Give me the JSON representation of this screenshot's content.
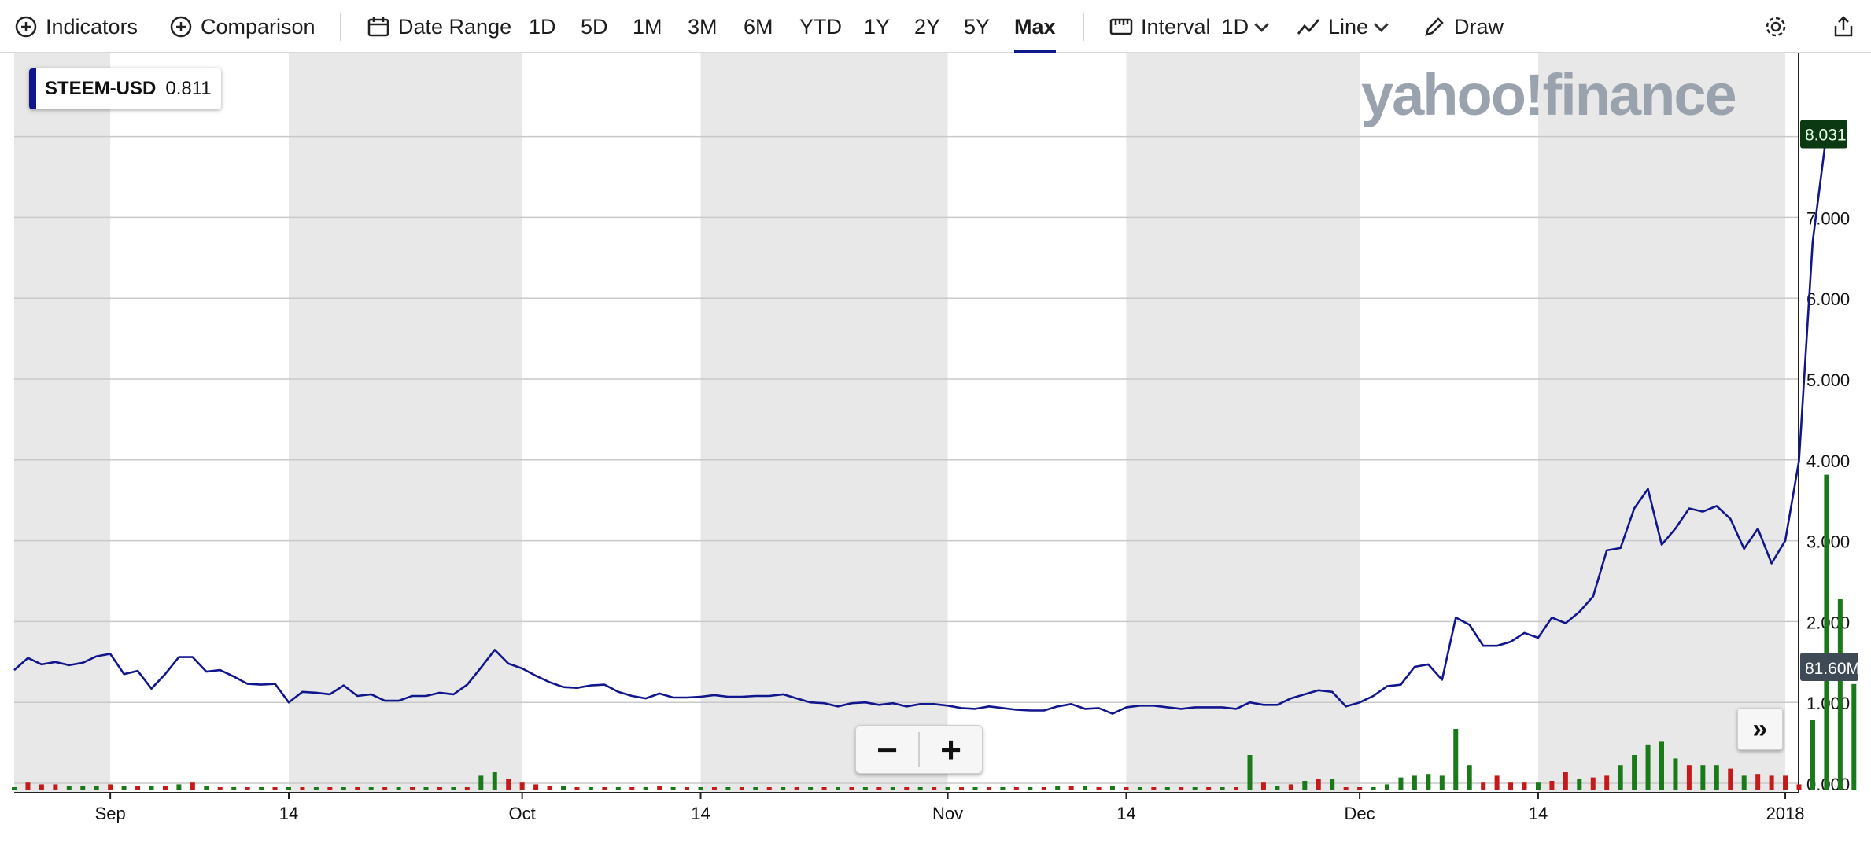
{
  "toolbar": {
    "indicators_label": "Indicators",
    "comparison_label": "Comparison",
    "date_range_label": "Date Range",
    "ranges": [
      "1D",
      "5D",
      "1M",
      "3M",
      "6M",
      "YTD",
      "1Y",
      "2Y",
      "5Y",
      "Max"
    ],
    "active_range": "Max",
    "interval_label": "Interval",
    "interval_value": "1D",
    "chart_type_label": "Line",
    "draw_label": "Draw"
  },
  "ticker": {
    "symbol": "STEEM-USD",
    "value": "0.811"
  },
  "logo_text": "yahoo!finance",
  "current_price_label": "8.031",
  "volume_label": "81.60M",
  "colors": {
    "line": "#12168c",
    "volume_up": "#1a7a1a",
    "volume_down": "#c51a1a",
    "band": "#e8e8e8",
    "accent": "#0f1a8c"
  },
  "chart_data": {
    "type": "line",
    "xlabel": "",
    "ylabel": "",
    "ylim": [
      0,
      9
    ],
    "yticks": [
      "0.000",
      "1.000",
      "2.000",
      "3.000",
      "4.000",
      "5.000",
      "6.000",
      "7.000"
    ],
    "x_start_date": "2017-08-25",
    "xticks": [
      "Sep",
      "14",
      "Oct",
      "14",
      "Nov",
      "14",
      "Dec",
      "14",
      "2018"
    ],
    "xtick_dates": [
      "2017-09-01",
      "2017-09-14",
      "2017-10-01",
      "2017-10-14",
      "2017-11-01",
      "2017-11-14",
      "2017-12-01",
      "2017-12-14",
      "2018-01-01"
    ],
    "grid": true,
    "series": [
      {
        "name": "STEEM-USD",
        "values": [
          1.4,
          1.55,
          1.47,
          1.5,
          1.46,
          1.49,
          1.57,
          1.6,
          1.35,
          1.39,
          1.17,
          1.35,
          1.56,
          1.56,
          1.38,
          1.4,
          1.32,
          1.23,
          1.22,
          1.23,
          1.0,
          1.13,
          1.12,
          1.1,
          1.21,
          1.08,
          1.1,
          1.02,
          1.02,
          1.08,
          1.08,
          1.12,
          1.1,
          1.22,
          1.43,
          1.65,
          1.48,
          1.42,
          1.33,
          1.25,
          1.19,
          1.18,
          1.21,
          1.22,
          1.13,
          1.08,
          1.05,
          1.11,
          1.06,
          1.06,
          1.07,
          1.09,
          1.07,
          1.07,
          1.08,
          1.08,
          1.1,
          1.05,
          1.0,
          0.99,
          0.95,
          0.99,
          1.0,
          0.97,
          0.99,
          0.95,
          0.98,
          0.98,
          0.96,
          0.93,
          0.92,
          0.95,
          0.93,
          0.91,
          0.9,
          0.9,
          0.95,
          0.98,
          0.92,
          0.93,
          0.86,
          0.94,
          0.96,
          0.96,
          0.94,
          0.92,
          0.94,
          0.94,
          0.94,
          0.92,
          1.0,
          0.97,
          0.97,
          1.05,
          1.1,
          1.15,
          1.13,
          0.95,
          1.0,
          1.08,
          1.2,
          1.22,
          1.44,
          1.47,
          1.28,
          2.05,
          1.96,
          1.7,
          1.7,
          1.75,
          1.86,
          1.8,
          2.05,
          1.98,
          2.12,
          2.31,
          2.88,
          2.91,
          3.4,
          3.64,
          2.95,
          3.15,
          3.4,
          3.36,
          3.43,
          3.27,
          2.9,
          3.15,
          2.72,
          3.0,
          3.99,
          6.7,
          8.03
        ],
        "volume_direction": [
          "u",
          "d",
          "d",
          "d",
          "u",
          "u",
          "u",
          "d",
          "u",
          "d",
          "u",
          "d",
          "u",
          "d",
          "u",
          "d",
          "u",
          "d",
          "u",
          "d",
          "u",
          "d",
          "u",
          "d",
          "u",
          "d",
          "u",
          "d",
          "u",
          "d",
          "u",
          "d",
          "u",
          "d",
          "u",
          "u",
          "d",
          "d",
          "d",
          "d",
          "u",
          "d",
          "u",
          "d",
          "u",
          "d",
          "u",
          "d",
          "u",
          "d",
          "u",
          "d",
          "u",
          "d",
          "u",
          "d",
          "u",
          "d",
          "u",
          "d",
          "u",
          "d",
          "u",
          "d",
          "u",
          "d",
          "u",
          "d",
          "u",
          "d",
          "u",
          "d",
          "u",
          "d",
          "u",
          "d",
          "u",
          "d",
          "u",
          "d",
          "u",
          "d",
          "u",
          "d",
          "u",
          "d",
          "u",
          "d",
          "u",
          "d",
          "u",
          "d",
          "u",
          "d",
          "u",
          "d",
          "u",
          "d",
          "d",
          "u",
          "u",
          "u",
          "u",
          "u",
          "u",
          "u",
          "u",
          "d",
          "d",
          "d",
          "d",
          "u",
          "d",
          "d",
          "u",
          "d",
          "d",
          "u",
          "u",
          "u",
          "u",
          "u",
          "d",
          "u",
          "u",
          "d",
          "u",
          "d",
          "d",
          "d",
          "d",
          "u",
          "u",
          "u",
          "u",
          "u"
        ],
        "volume_millions": [
          1,
          4,
          3,
          3,
          2,
          2,
          2,
          3,
          2,
          2,
          2,
          2,
          3,
          4,
          2,
          1,
          1,
          1,
          1,
          1,
          1,
          1,
          1,
          1,
          1,
          1,
          1,
          1,
          1,
          1,
          1,
          1,
          1,
          1,
          8,
          10,
          6,
          4,
          3,
          2,
          2,
          1,
          1,
          1,
          1,
          1,
          1,
          2,
          1,
          1,
          1,
          1,
          1,
          1,
          1,
          1,
          1,
          1,
          1,
          1,
          1,
          1,
          1,
          1,
          1,
          1,
          1,
          1,
          1,
          1,
          1,
          1,
          1,
          1,
          1,
          1,
          2,
          2,
          2,
          1,
          2,
          1,
          1,
          1,
          1,
          1,
          1,
          1,
          1,
          1,
          20,
          4,
          2,
          3,
          5,
          6,
          6,
          1,
          1,
          1,
          3,
          7,
          8,
          9,
          8,
          35,
          14,
          4,
          8,
          4,
          4,
          4,
          5,
          10,
          6,
          7,
          8,
          14,
          20,
          26,
          28,
          18,
          14,
          14,
          14,
          12,
          8,
          9,
          8,
          8,
          3,
          40,
          182,
          110,
          61
        ]
      }
    ]
  }
}
